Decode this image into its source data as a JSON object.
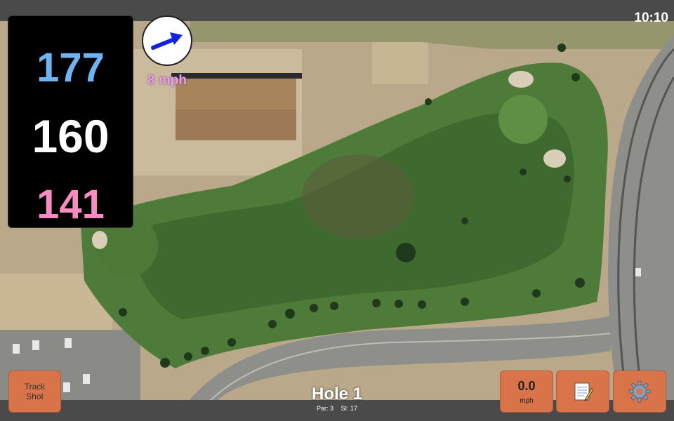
{
  "status": {
    "time": "10:10"
  },
  "distances": {
    "back": "177",
    "middle": "160",
    "front": "141"
  },
  "wind": {
    "speed_label": "8 mph",
    "direction_icon": "wind-arrow-icon"
  },
  "buttons": {
    "track_shot_label": "Track\nShot",
    "speed_value": "0.0",
    "speed_unit": "mph",
    "notes_icon": "scorecard-notes-icon",
    "settings_icon": "gear-icon"
  },
  "hole": {
    "title": "Hole 1",
    "par": "Par: 3",
    "stroke_index": "SI: 17"
  },
  "colors": {
    "back_distance": "#6fb4f2",
    "middle_distance": "#ffffff",
    "front_distance": "#f68cbf",
    "button_bg": "#d9734a",
    "wind_label": "#e8a0e6"
  }
}
